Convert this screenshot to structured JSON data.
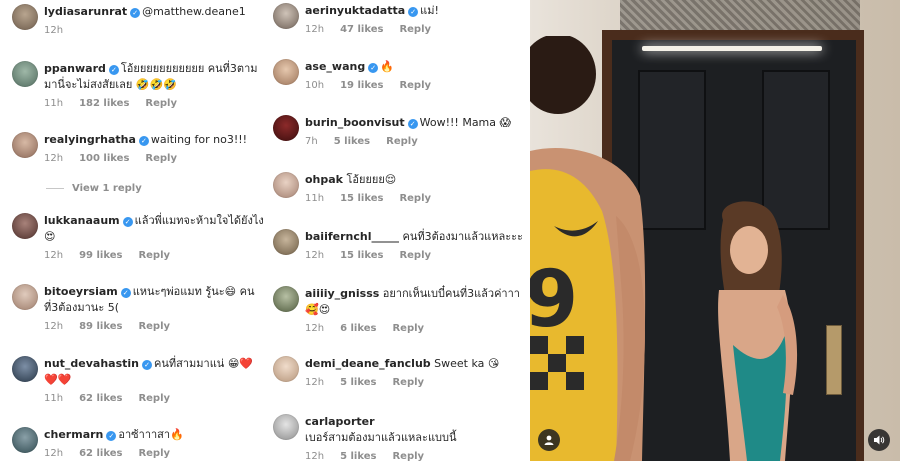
{
  "left_comments": [
    {
      "user": "lydiasarunrat",
      "verified": true,
      "text": "@matthew.deane1",
      "time": "12h",
      "likes": "",
      "reply": ""
    },
    {
      "user": "ppanward",
      "verified": true,
      "text": "โอ้ยยยยยยยยยยย คนที่3ตามมานี่จะไม่สงสัยเลย 🤣🤣🤣",
      "time": "11h",
      "likes": "182 likes",
      "reply": "Reply"
    },
    {
      "user": "realyingrhatha",
      "verified": true,
      "text": "waiting for no3!!!",
      "time": "12h",
      "likes": "100 likes",
      "reply": "Reply",
      "view_replies": "View 1 reply"
    },
    {
      "user": "lukkanaaum",
      "verified": true,
      "text": "แล้วพี่แมทจะห้ามใจได้ยังไง 😍",
      "time": "12h",
      "likes": "99 likes",
      "reply": "Reply"
    },
    {
      "user": "bitoeyrsiam",
      "verified": true,
      "text": "แหนะๆพ่อแมท รู้นะ😄 คนที่3ต้องมานะ 5(",
      "time": "12h",
      "likes": "89 likes",
      "reply": "Reply"
    },
    {
      "user": "nut_devahastin",
      "verified": true,
      "text": "คนที่สามมาแน่ 😁❤️❤️❤️",
      "time": "11h",
      "likes": "62 likes",
      "reply": "Reply"
    },
    {
      "user": "chermarn",
      "verified": true,
      "text": "อาซ้าาาสา🔥",
      "time": "12h",
      "likes": "62 likes",
      "reply": "Reply"
    }
  ],
  "mid_comments": [
    {
      "user": "aerinyuktadatta",
      "verified": true,
      "text": "แม่!",
      "time": "12h",
      "likes": "47 likes",
      "reply": "Reply"
    },
    {
      "user": "ase_wang",
      "verified": true,
      "text": "🔥",
      "time": "10h",
      "likes": "19 likes",
      "reply": "Reply"
    },
    {
      "user": "burin_boonvisut",
      "verified": true,
      "text": "Wow!!! Mama 😱",
      "time": "7h",
      "likes": "5 likes",
      "reply": "Reply"
    },
    {
      "user": "ohpak",
      "verified": false,
      "text": "โอ้ยยยย😌",
      "time": "11h",
      "likes": "15 likes",
      "reply": "Reply"
    },
    {
      "user": "baiifernchl_____",
      "verified": false,
      "text": "คนที่3ต้องมาแล้วแหละะะ",
      "time": "12h",
      "likes": "15 likes",
      "reply": "Reply"
    },
    {
      "user": "aiiiiy_gnisss",
      "verified": false,
      "text": "อยากเห็นเบบี๋คนที่3แล้วค่าาา🥰😍",
      "time": "12h",
      "likes": "6 likes",
      "reply": "Reply"
    },
    {
      "user": "demi_deane_fanclub",
      "verified": false,
      "text": "Sweet ka 😘",
      "time": "12h",
      "likes": "5 likes",
      "reply": "Reply"
    },
    {
      "user": "carlaporter",
      "verified": false,
      "text": "เบอร์สามต้องมาแล้วแหละแบบนี้",
      "time": "12h",
      "likes": "5 likes",
      "reply": "Reply"
    }
  ],
  "photo": {
    "jersey_number": "9"
  },
  "colors": {
    "verified": "#3897f0",
    "muted": "#8e8e8e",
    "text": "#262626",
    "jersey": "#e8b92e"
  },
  "icons": {
    "mute": "speaker-icon",
    "profile": "user-icon",
    "verified": "verified-badge-icon"
  }
}
